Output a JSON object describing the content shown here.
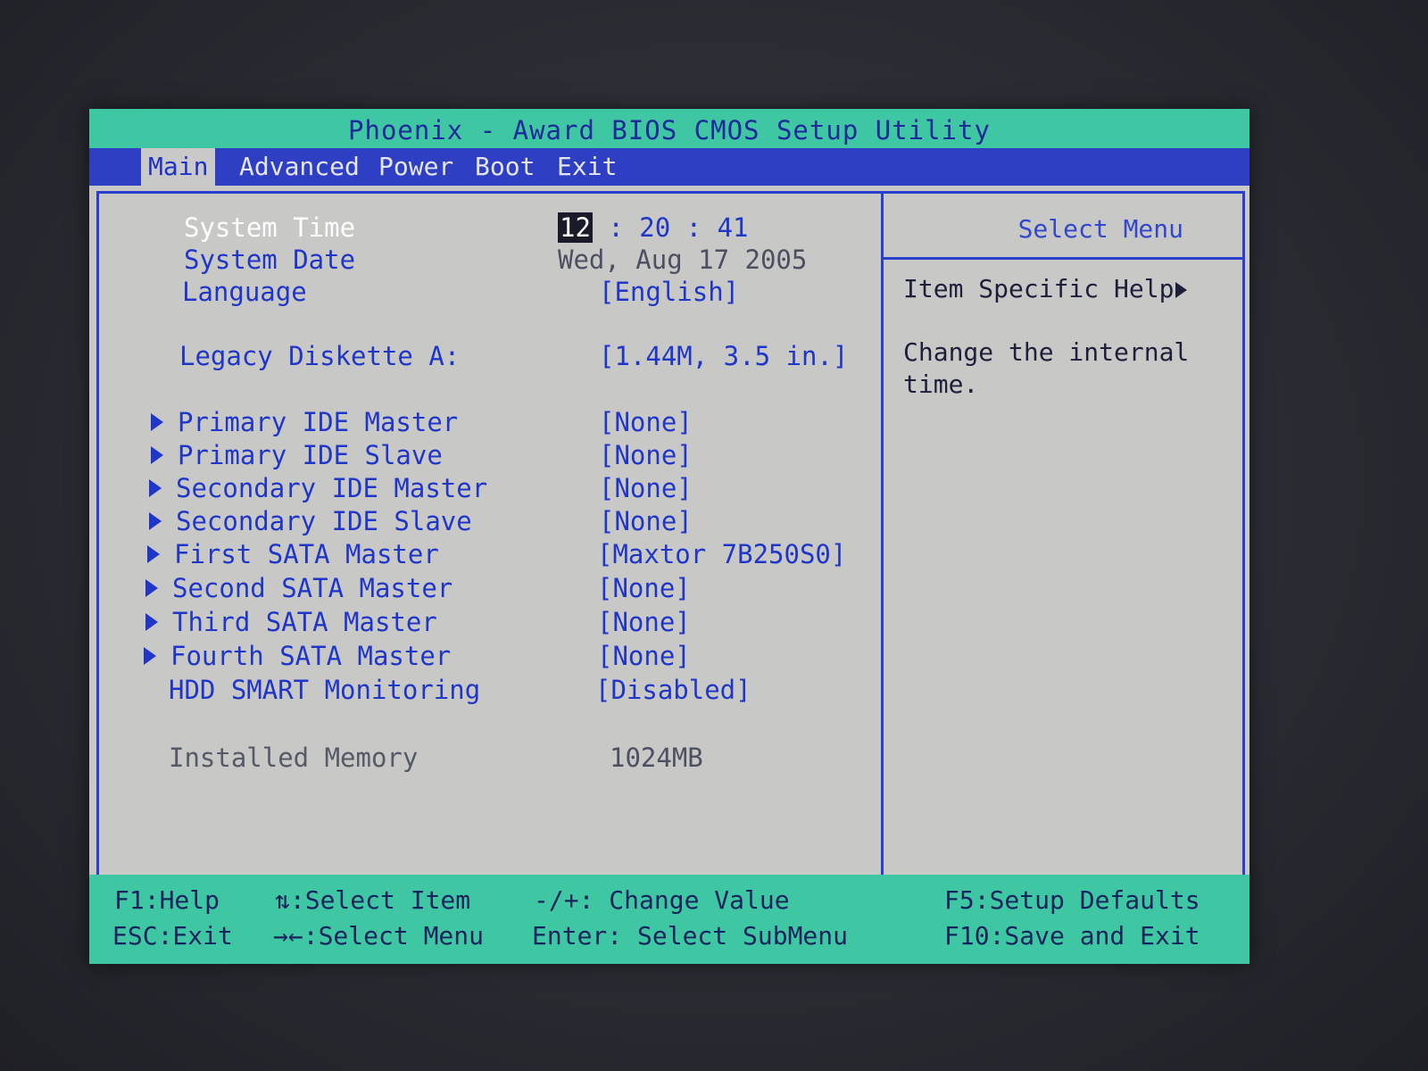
{
  "title": "Phoenix - Award BIOS CMOS Setup Utility",
  "menu": [
    "Main",
    "Advanced",
    "Power",
    "Boot",
    "Exit"
  ],
  "main": {
    "system_time": {
      "label": "System Time",
      "hh": "12",
      "rest": " : 20 : 41"
    },
    "system_date": {
      "label": "System Date",
      "value": "Wed, Aug 17 2005"
    },
    "language": {
      "label": "Language",
      "value": "[English]"
    },
    "diskette": {
      "label": "Legacy Diskette A:",
      "value": "[1.44M, 3.5 in.]"
    },
    "devices": [
      {
        "label": "Primary IDE Master",
        "value": "[None]"
      },
      {
        "label": "Primary IDE Slave",
        "value": "[None]"
      },
      {
        "label": "Secondary IDE Master",
        "value": "[None]"
      },
      {
        "label": "Secondary IDE Slave",
        "value": "[None]"
      },
      {
        "label": "First SATA Master",
        "value": "[Maxtor 7B250S0]"
      },
      {
        "label": "Second SATA Master",
        "value": "[None]"
      },
      {
        "label": "Third SATA Master",
        "value": "[None]"
      },
      {
        "label": "Fourth SATA Master",
        "value": "[None]"
      }
    ],
    "smart": {
      "label": "HDD SMART Monitoring",
      "value": "[Disabled]"
    },
    "memory": {
      "label": "Installed Memory",
      "value": "1024MB"
    }
  },
  "help": {
    "header": "Select Menu",
    "subheader": "Item Specific Help",
    "text": "Change the internal time."
  },
  "footer": {
    "f1": "F1:Help",
    "esc": "ESC:Exit",
    "select_item": "⇅:Select Item",
    "select_menu": "→←:Select Menu",
    "change_value": "-/+: Change Value",
    "enter": "Enter: Select SubMenu",
    "f5": "F5:Setup Defaults",
    "f10": "F10:Save and Exit"
  }
}
